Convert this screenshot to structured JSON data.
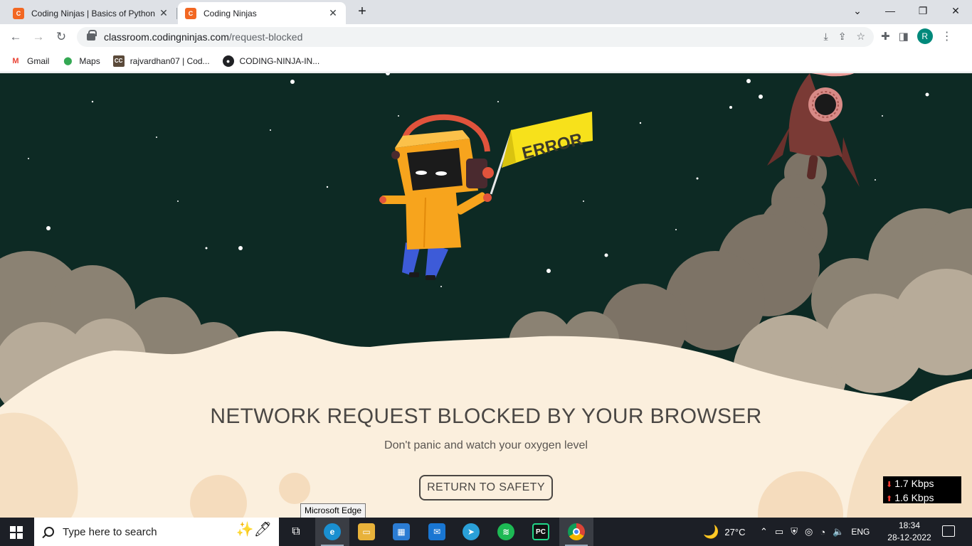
{
  "browser": {
    "tabs": [
      {
        "title": "Coding Ninjas | Basics of Python",
        "active": false
      },
      {
        "title": "Coding Ninjas",
        "active": true
      }
    ],
    "url_host": "classroom.codingninjas.com",
    "url_path": "/request-blocked",
    "bookmarks": [
      {
        "label": "Gmail",
        "icon": "gmail-icon"
      },
      {
        "label": "Maps",
        "icon": "maps-icon"
      },
      {
        "label": "rajvardhan07 | Cod...",
        "icon": "codingninjas-icon"
      },
      {
        "label": "CODING-NINJA-IN...",
        "icon": "github-icon"
      }
    ],
    "profile_initial": "R"
  },
  "page": {
    "flag_text": "ERROR",
    "headline": "NETWORK REQUEST BLOCKED BY YOUR BROWSER",
    "subtext": "Don't panic and watch your oxygen level",
    "cta_label": "RETURN TO SAFETY",
    "colors": {
      "sky": "#0d2a24",
      "flag": "#f7e11b",
      "robot": "#f7a41d",
      "rocket": "#7a3a35",
      "cloud_dark": "#8b8273",
      "cloud_light": "#fbefdd"
    }
  },
  "overlay": {
    "tooltip": "Microsoft Edge",
    "net_down": "1.7 Kbps",
    "net_up": "1.6 Kbps"
  },
  "taskbar": {
    "search_placeholder": "Type here to search",
    "weather": "27°C",
    "language": "ENG",
    "time": "18:34",
    "date": "28-12-2022"
  }
}
